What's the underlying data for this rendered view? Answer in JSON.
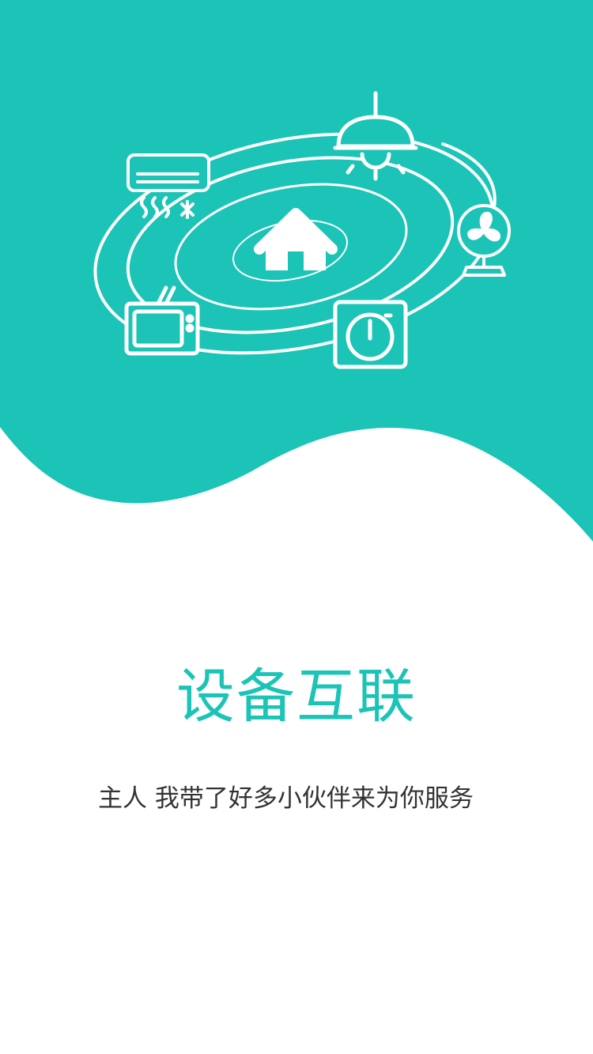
{
  "onboarding": {
    "title": "设备互联",
    "subtitle": "主人 我带了好多小伙伴来为你服务"
  },
  "illustration": {
    "center_icon": "home-icon",
    "devices": [
      "air-conditioner-icon",
      "ceiling-lamp-icon",
      "fan-icon",
      "tv-icon",
      "washing-machine-icon"
    ]
  },
  "colors": {
    "accent": "#1bc4b6",
    "background": "#ffffff",
    "text": "#333333"
  }
}
